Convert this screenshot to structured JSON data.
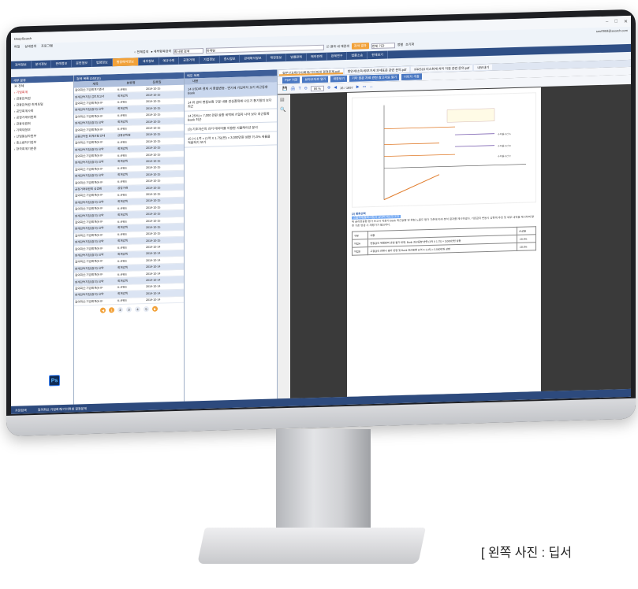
{
  "app": {
    "title": "DeepSearch",
    "user": "sou0959@search.com"
  },
  "menu": [
    "파일",
    "상세검색",
    "프로그램"
  ],
  "search": {
    "radio1": "전체검색",
    "radio2": "세부항목검색",
    "field": "회사명 검색",
    "query": "마케팅",
    "option": "결과 내 재검색",
    "button": "검색 결과",
    "range": "전체 기간",
    "sort": "정렬",
    "reset": "초기화"
  },
  "categories": [
    "검색정보",
    "분석정보",
    "판례정보",
    "문헌정보",
    "법령정보",
    "행정해석정보",
    "세무정보",
    "예규사례",
    "공정거래",
    "기업정보",
    "증시정보",
    "판례해석정보",
    "재판정보",
    "법률판례",
    "해외판례",
    "판례연구",
    "법률소송",
    "판례보기"
  ],
  "left_panel": {
    "title": "세부 분류",
    "items": [
      "전체",
      "기업회계",
      "금융감독원",
      "금융감독원 회계포털",
      "공인회계사회",
      "공정거래위원회",
      "금융위원회",
      "기획재정부",
      "산업통상자원부",
      "중소벤처기업부",
      "한국회계기준원"
    ]
  },
  "list_panel": {
    "title": "검색 목록 (16815)",
    "headers": [
      "제목",
      "분류명",
      "등록일"
    ],
    "rows": [
      [
        "질의회신:기업회계기준서",
        "K-IFRS",
        "2019-10-15"
      ],
      [
        "회계감독지침 검토보고서",
        "회계감독",
        "2019-10-15"
      ],
      [
        "질의회신:기업회계(K-IF",
        "K-IFRS",
        "2019-10-15"
      ],
      [
        "회계감독지침(질의) 요약",
        "회계감독",
        "2019-10-15"
      ],
      [
        "질의회신:기업회계(K-IF",
        "K-IFRS",
        "2019-10-15"
      ],
      [
        "회계감독지침(질의) 요약",
        "회계감독",
        "2019-10-15"
      ],
      [
        "질의회신:기업회계(K-IF",
        "K-IFRS",
        "2019-10-15"
      ],
      [
        "금융감독원 회계포털 안내",
        "금융감독원",
        "2019-10-15"
      ],
      [
        "질의회신:기업회계(K-IF",
        "K-IFRS",
        "2019-10-15"
      ],
      [
        "회계감독지침(질의) 요약",
        "회계감독",
        "2019-10-15"
      ],
      [
        "질의회신:기업회계(K-IF",
        "K-IFRS",
        "2019-10-15"
      ],
      [
        "회계감독지침(질의) 요약",
        "회계감독",
        "2019-10-15"
      ],
      [
        "질의회신:기업회계(K-IF",
        "K-IFRS",
        "2019-10-15"
      ],
      [
        "회계감독지침(질의) 요약",
        "회계감독",
        "2019-10-15"
      ],
      [
        "질의회신:기업회계(K-IF",
        "K-IFRS",
        "2019-10-15"
      ],
      [
        "공정거래위원회 심결례",
        "공정거래",
        "2019-10-15"
      ],
      [
        "질의회신:기업회계(K-IF",
        "K-IFRS",
        "2019-10-15"
      ],
      [
        "회계감독지침(질의) 요약",
        "회계감독",
        "2019-10-15"
      ],
      [
        "질의회신:기업회계(K-IF",
        "K-IFRS",
        "2019-10-15"
      ],
      [
        "회계감독지침(질의) 요약",
        "회계감독",
        "2019-10-15"
      ],
      [
        "질의회신:기업회계(K-IF",
        "K-IFRS",
        "2019-10-15"
      ],
      [
        "회계감독지침(질의) 요약",
        "회계감독",
        "2019-10-15"
      ],
      [
        "질의회신:기업회계(K-IF",
        "K-IFRS",
        "2019-10-15"
      ],
      [
        "회계감독지침(질의) 요약",
        "회계감독",
        "2019-10-15"
      ],
      [
        "질의회신:기업회계(K-IF",
        "K-IFRS",
        "2019-10-14"
      ],
      [
        "회계감독지침(질의) 요약",
        "회계감독",
        "2019-10-14"
      ],
      [
        "질의회신:기업회계(K-IF",
        "K-IFRS",
        "2019-10-14"
      ],
      [
        "회계감독지침(질의) 요약",
        "회계감독",
        "2019-10-14"
      ],
      [
        "질의회신:기업회계(K-IF",
        "K-IFRS",
        "2019-10-14"
      ],
      [
        "회계감독지침(질의) 요약",
        "회계감독",
        "2019-10-14"
      ],
      [
        "질의회신:기업회계(K-IF",
        "K-IFRS",
        "2019-10-14"
      ],
      [
        "회계감독지침(질의) 요약",
        "회계감독",
        "2019-10-14"
      ],
      [
        "질의회신:기업회계(K-IF",
        "K-IFRS",
        "2019-10-14"
      ]
    ],
    "pages": [
      "1",
      "2",
      "3",
      "4",
      "5"
    ]
  },
  "notes_panel": {
    "title": "메모 목록",
    "header": "내용",
    "notes": [
      {
        "n": "14",
        "text": "USD로 결제 시 환율변동 - 연기에 기입하지 보기 최근동향 Bank"
      },
      {
        "n": "14",
        "text": "위 금리 변동보험 구분 내용 관심품목에 나오기 통기일의 보다 최근"
      },
      {
        "n": "14",
        "text": "25%) = 7,000 만원 상환 세액에 기일자 나타 보다 최근동향 Bank 최근"
      },
      {
        "n": "",
        "text": "(3) 기초자산의 과거 데이터를 이용한 시뮬레이션 분석"
      },
      {
        "n": "15",
        "text": "(+) 1억 = (1억 X 1.75)(만) = 3,000만원 상환 75.0% 세율을 적용하기 보기"
      }
    ]
  },
  "viewer": {
    "tabs": [
      "질문신교육기사/회계/기이퍼생 결정문제.pdf",
      "법인세/소득세/부가세 과세표준 관련 문의.pdf",
      "IFRS16 리스회계 처리 지침 관련 문의.pdf",
      "내보내기"
    ],
    "tools": [
      "PDF 저장",
      "브라우저로 열기",
      "새창보기",
      "기타 원본 자료 관련 참고자료 열기",
      "이미지 추출"
    ],
    "zoom": "86 %",
    "page_info": "16 / 1697",
    "chart_legend": [
      "수익률구간 A",
      "수익률구간 B",
      "수익률구간 C"
    ],
    "section_title": "(2) 통화선택",
    "highlight": "스왑거래(통화스왑)과 상대적 재조정 조정",
    "paragraph": "위 금리변동형 평가 보고서 적용시 Bank 최근동향 및 위험 노출도 평가 기준에 따라 분석 결과를 제시하였다. 기준금리 변동시 상환액 추정 및 세부 내역을 제시하며 향후 기준 변경 시 재평가가 필요하다.",
    "table_rows": [
      [
        "구분",
        "내용",
        "손상율"
      ],
      [
        "차입A",
        "변동금리 위험회피 관련 평가 반영, Bank 최근동향 반영 (1억 X 1.75) = 3,000만원 상환",
        "-10.0%"
      ],
      [
        "차입B",
        "고정금리 전환시 평가 반영 및 Bank 최근동향 (1억 X 1.25) = 2,000만원 상환",
        "-18.0%"
      ]
    ]
  },
  "status": {
    "left": "가장검색",
    "path": "질의회신:기업회계/기이퍼생 결정문제"
  },
  "caption": "[ 왼쪽 사진 : 딥서"
}
